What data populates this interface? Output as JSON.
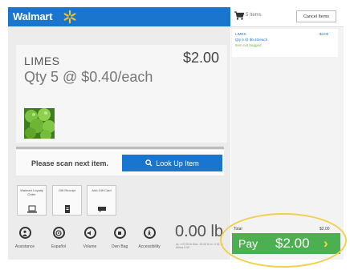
{
  "header": {
    "brand": "Walmart",
    "logo_icon": "spark-icon",
    "brand_color": "#1a75cf"
  },
  "item": {
    "name": "LIMES",
    "price": "$2.00",
    "quantity_line": "Qty 5 @ $0.40/each",
    "image_icon": "limes-image"
  },
  "scan": {
    "prompt": "Please scan next item.",
    "lookup_label": "Look Up Item"
  },
  "tiles": [
    {
      "label": "Walmart Loyalty Order",
      "icon": "laptop-icon"
    },
    {
      "label": "Gift Receipt",
      "icon": "receipt-icon"
    },
    {
      "label": "Add Gift Card",
      "icon": "card-icon"
    }
  ],
  "toolbar": [
    {
      "label": "Assistance",
      "icon": "assistance-icon"
    },
    {
      "label": "Español",
      "icon": "language-icon"
    },
    {
      "label": "Volume",
      "icon": "volume-icon"
    },
    {
      "label": "Own Bag",
      "icon": "bag-icon"
    },
    {
      "label": "Accessibility",
      "icon": "accessibility-icon"
    }
  ],
  "scale": {
    "weight": "0.00 lb",
    "note": "wt. ±+0.00 lb Max. 30.00 Ib e= 0.01 lb Minuz 0.00"
  },
  "cart": {
    "count_label": "5 Items",
    "cancel_label": "Cancel Items",
    "items": [
      {
        "name": "LIMES",
        "price": "$2.00",
        "qty": "Qty 5 @ $0.40/each",
        "status": "Item not bagged"
      }
    ]
  },
  "totals": {
    "label": "Total",
    "value": "$2.00"
  },
  "pay": {
    "label": "Pay",
    "amount": "$2.00",
    "color": "#4caf50",
    "chevron_color": "#fdd835"
  }
}
